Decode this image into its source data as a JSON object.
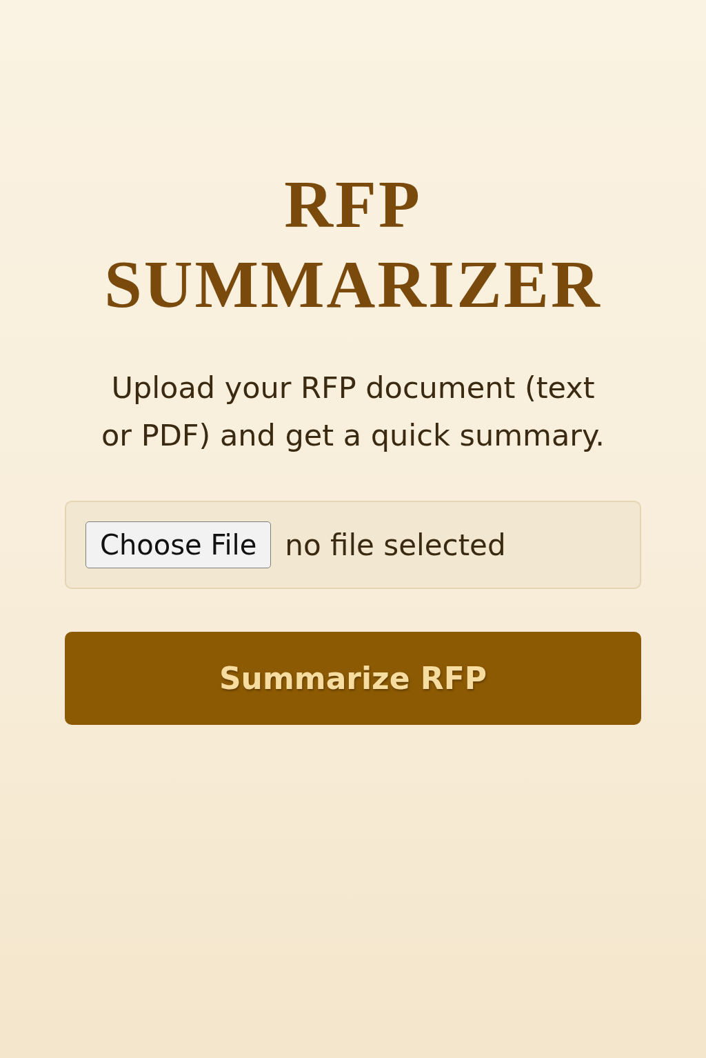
{
  "title": "RFP SUMMARIZER",
  "subtitle": "Upload your RFP document (text or PDF) and get a quick summary.",
  "file_input": {
    "button": "Choose File",
    "status": "no file selected"
  },
  "submit_button": {
    "label": "Summarize RFP"
  }
}
